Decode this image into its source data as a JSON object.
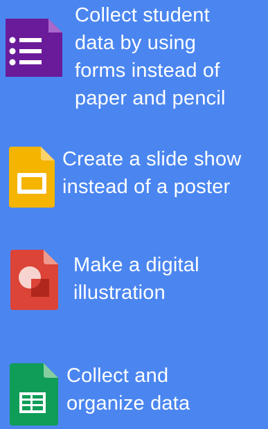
{
  "items": [
    {
      "icon": "google-forms-icon",
      "text": "Collect student\ndata by using\nforms instead of\npaper and pencil",
      "icon_color": "#6a1b9a"
    },
    {
      "icon": "google-slides-icon",
      "text": "Create a slide show\ninstead of a poster",
      "icon_color": "#f4b400"
    },
    {
      "icon": "google-drawings-icon",
      "text": "Make a digital\nillustration",
      "icon_color": "#db4437"
    },
    {
      "icon": "google-sheets-icon",
      "text": "Collect and\norganize data",
      "icon_color": "#0f9d58"
    }
  ],
  "background_color": "#4b86f0"
}
